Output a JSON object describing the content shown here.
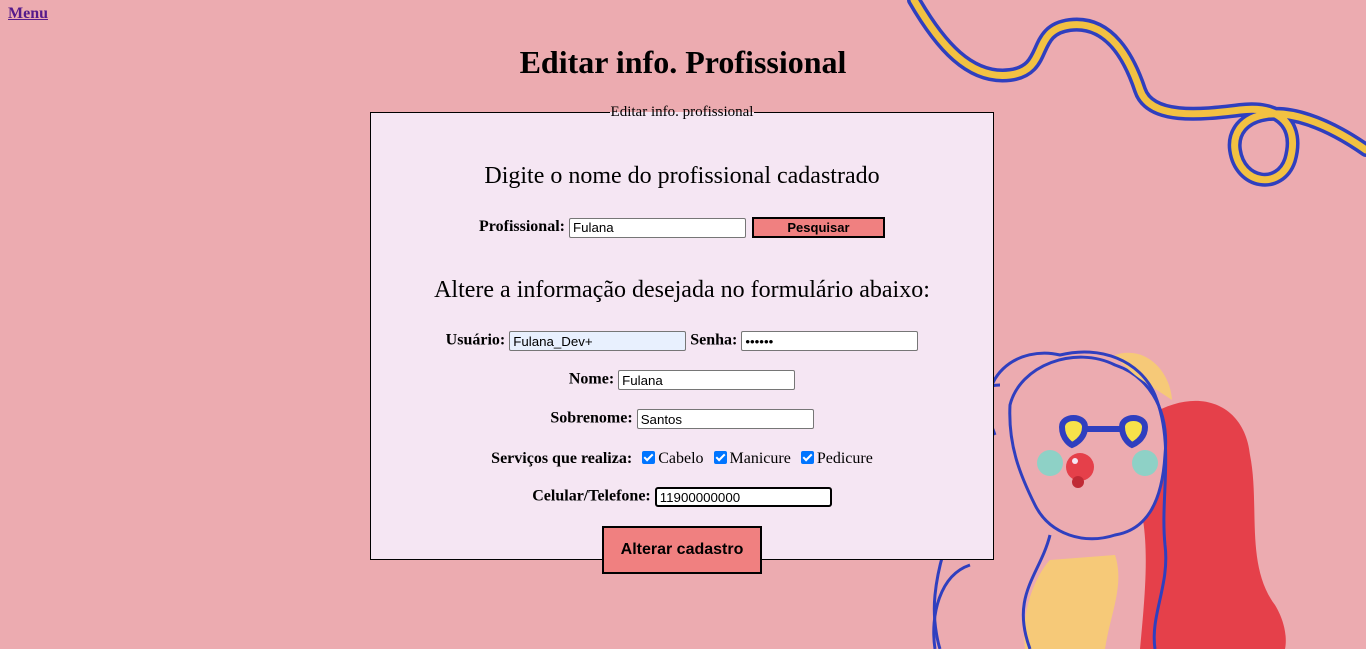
{
  "nav": {
    "menu_label": "Menu"
  },
  "page": {
    "title": "Editar info. Profissional"
  },
  "form": {
    "legend": "Editar info. profissional",
    "search": {
      "heading": "Digite o nome do profissional cadastrado",
      "label": "Profissional:",
      "value": "Fulana",
      "button_label": "Pesquisar"
    },
    "edit": {
      "heading": "Altere a informação desejada no formulário abaixo:",
      "usuario_label": "Usuário:",
      "usuario_value": "Fulana_Dev+",
      "senha_label": "Senha:",
      "senha_value": "••••••",
      "nome_label": "Nome:",
      "nome_value": "Fulana",
      "sobrenome_label": "Sobrenome:",
      "sobrenome_value": "Santos",
      "servicos_label": "Serviços que realiza:",
      "servicos": [
        {
          "label": "Cabelo",
          "checked": true
        },
        {
          "label": "Manicure",
          "checked": true
        },
        {
          "label": "Pedicure",
          "checked": true
        }
      ],
      "telefone_label": "Celular/Telefone:",
      "telefone_value": "11900000000",
      "submit_label": "Alterar cadastro"
    }
  },
  "colors": {
    "background": "#ecabb0",
    "form_background": "#f5e6f3",
    "button": "#f08080",
    "ribbon_yellow": "#f2c142",
    "ribbon_blue": "#2f3fbf",
    "hair_red": "#e5404a"
  }
}
